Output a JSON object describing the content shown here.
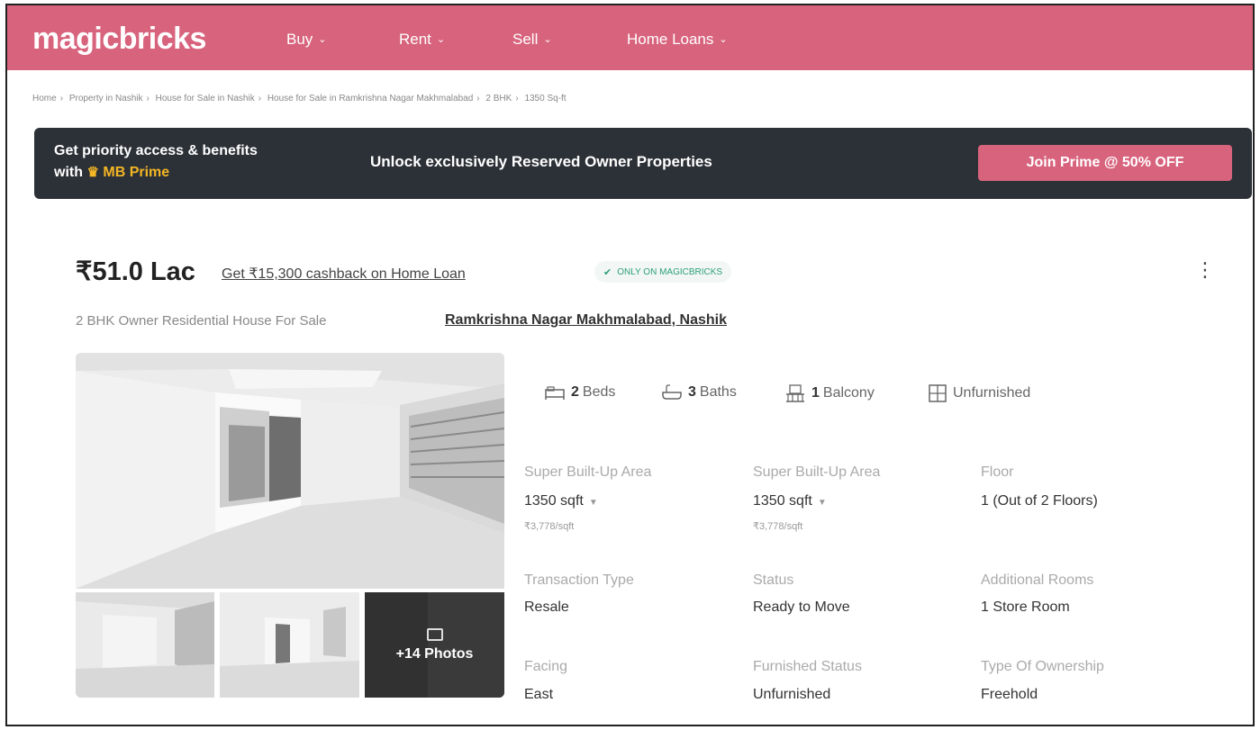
{
  "nav": {
    "logo": "magicbricks",
    "items": [
      {
        "label": "Buy"
      },
      {
        "label": "Rent"
      },
      {
        "label": "Sell"
      },
      {
        "label": "Home Loans"
      }
    ]
  },
  "breadcrumb": [
    "Home",
    "Property in Nashik",
    "House for Sale in Nashik",
    "House for Sale in Ramkrishna Nagar Makhmalabad",
    "2 BHK",
    "1350 Sq-ft"
  ],
  "prime": {
    "line1": "Get priority access & benefits",
    "line2_prefix": "with",
    "brand": "MB Prime",
    "headline": "Unlock exclusively Reserved Owner Properties",
    "cta": "Join Prime @ 50% OFF"
  },
  "listing": {
    "price": "₹51.0 Lac",
    "cashback": "Get ₹15,300 cashback on Home Loan",
    "badge": "ONLY ON MAGICBRICKS",
    "subtitle": "2 BHK Owner Residential House For Sale",
    "locality": "Ramkrishna Nagar Makhmalabad, Nashik",
    "more_photos": "+14 Photos"
  },
  "amenities": {
    "beds_num": "2",
    "beds_label": "Beds",
    "baths_num": "3",
    "baths_label": "Baths",
    "balcony_num": "1",
    "balcony_label": "Balcony",
    "furnishing": "Unfurnished"
  },
  "details": {
    "area1_label": "Super Built-Up Area",
    "area1_value": "1350 sqft",
    "area1_rate": "₹3,778/sqft",
    "area2_label": "Super Built-Up Area",
    "area2_value": "1350 sqft",
    "area2_rate": "₹3,778/sqft",
    "floor_label": "Floor",
    "floor_value": "1 (Out of 2 Floors)",
    "transaction_label": "Transaction Type",
    "transaction_value": "Resale",
    "status_label": "Status",
    "status_value": "Ready to Move",
    "rooms_label": "Additional Rooms",
    "rooms_value": "1 Store Room",
    "facing_label": "Facing",
    "facing_value": "East",
    "furnished_label": "Furnished Status",
    "furnished_value": "Unfurnished",
    "ownership_label": "Type Of Ownership",
    "ownership_value": "Freehold"
  },
  "colors": {
    "brand": "#d8637d",
    "banner": "#2c3137",
    "prime_gold": "#f3b625",
    "badge_green": "#2ea07a"
  }
}
